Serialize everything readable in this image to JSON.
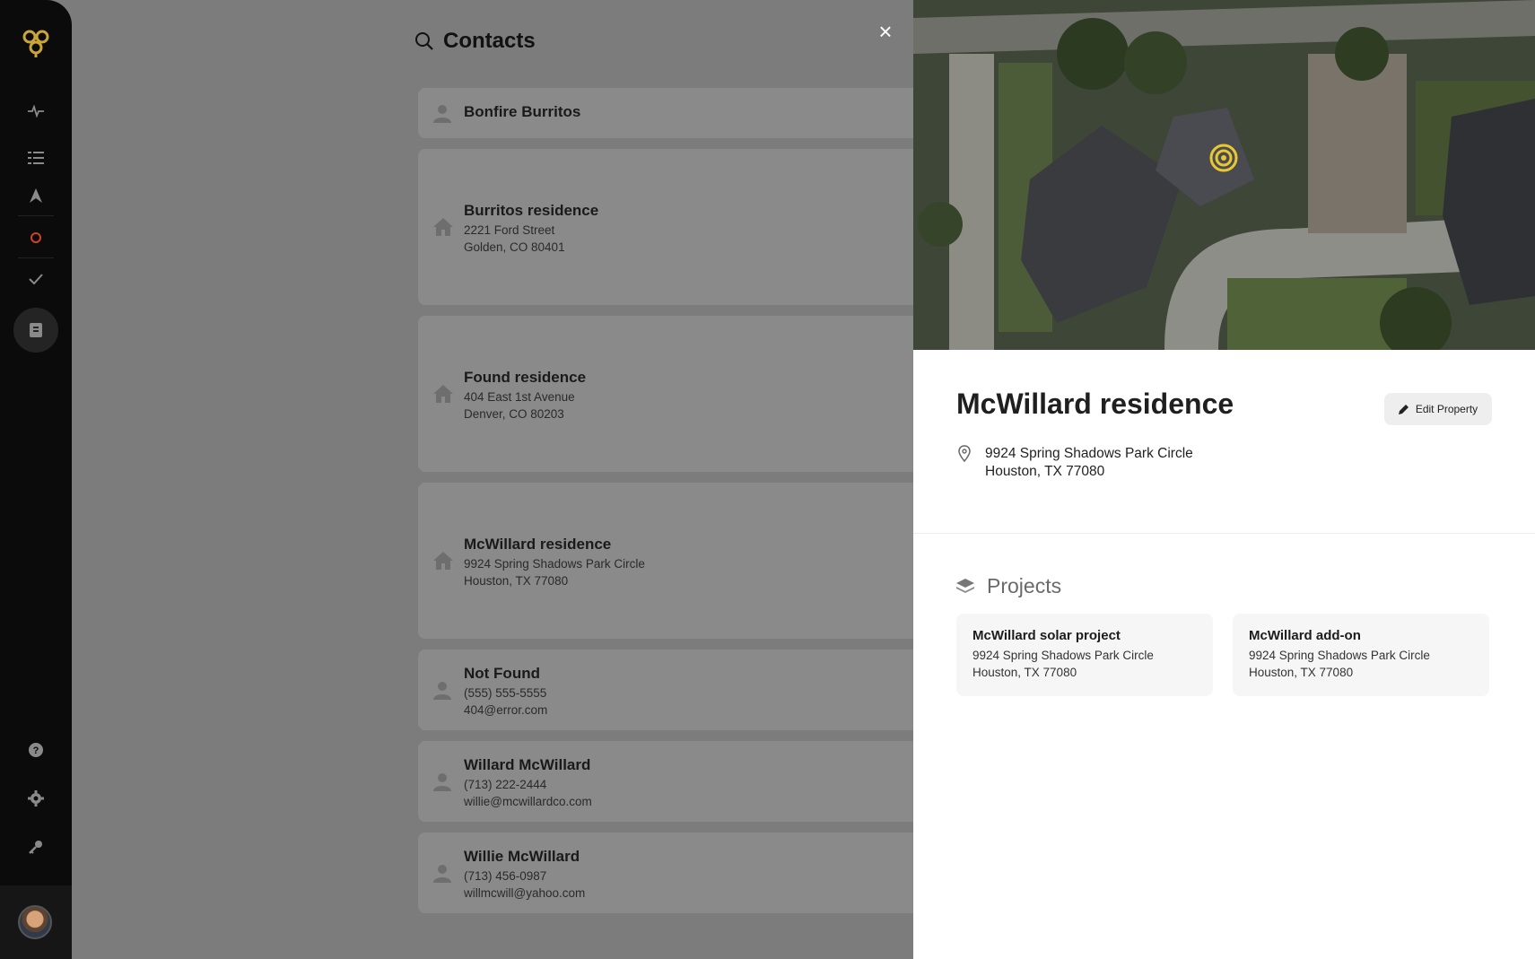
{
  "sidebar": {
    "icons": [
      "logo-icon",
      "activity-icon",
      "list-icon",
      "navigation-icon",
      "record-icon",
      "check-icon",
      "contacts-book-icon",
      "help-icon",
      "gear-icon",
      "key-icon"
    ]
  },
  "contacts": {
    "title": "Contacts",
    "items": [
      {
        "type": "person",
        "name": "Bonfire Burritos",
        "line1": "",
        "line2": ""
      },
      {
        "type": "property",
        "name": "Burritos residence",
        "line1": "2221 Ford Street",
        "line2": "Golden, CO 80401"
      },
      {
        "type": "property",
        "name": "Found residence",
        "line1": "404 East 1st Avenue",
        "line2": "Denver, CO 80203"
      },
      {
        "type": "property",
        "name": "McWillard residence",
        "line1": "9924 Spring Shadows Park Circle",
        "line2": "Houston, TX 77080"
      },
      {
        "type": "person",
        "name": "Not Found",
        "line1": "(555) 555-5555",
        "line2": "404@error.com"
      },
      {
        "type": "person",
        "name": "Willard McWillard",
        "line1": "(713) 222-2444",
        "line2": "willie@mcwillardco.com"
      },
      {
        "type": "person",
        "name": "Willie McWillard",
        "line1": "(713) 456-0987",
        "line2": "willmcwill@yahoo.com"
      }
    ]
  },
  "close_label": "×",
  "detail": {
    "title": "McWillard residence",
    "edit_label": "Edit Property",
    "address_line1": "9924 Spring Shadows Park Circle",
    "address_line2": "Houston, TX 77080",
    "projects_label": "Projects",
    "projects": [
      {
        "name": "McWillard solar project",
        "line1": "9924 Spring Shadows Park Circle",
        "line2": "Houston, TX 77080"
      },
      {
        "name": "McWillard add-on",
        "line1": "9924 Spring Shadows Park Circle",
        "line2": "Houston, TX 77080"
      }
    ]
  },
  "colors": {
    "accent_yellow": "#e8c832",
    "sidebar_bg": "#0b0b0b",
    "overlay": "#7c7c7c",
    "record_red": "#d0402a"
  }
}
